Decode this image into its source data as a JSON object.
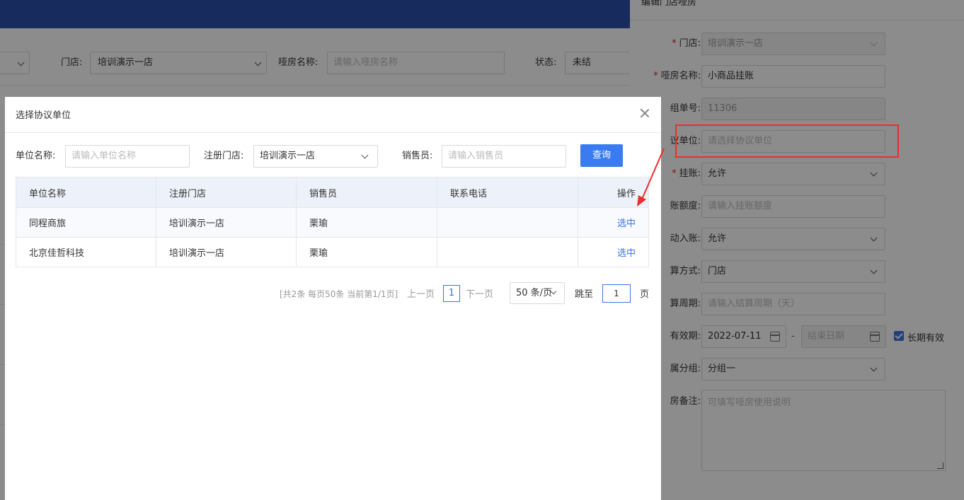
{
  "background": {
    "store_label": "门店:",
    "store_value": "培训演示一店",
    "room_name_label": "哑房名称:",
    "room_name_placeholder": "请输入哑房名称",
    "status_label": "状态:",
    "status_value": "未结"
  },
  "drawer": {
    "title": "编辑门店哑房",
    "fields": {
      "store": {
        "label": "门店:",
        "value": "培训演示一店"
      },
      "room_name": {
        "label": "哑房名称:",
        "value": "小商品挂账"
      },
      "group_no": {
        "label": "组单号:",
        "value": "11306"
      },
      "agreement_unit": {
        "label": "议单位:",
        "placeholder": "请选择协议单位"
      },
      "credit": {
        "label": "挂账:",
        "value": "允许"
      },
      "credit_limit": {
        "label": "账额度:",
        "placeholder": "请输入挂账额度"
      },
      "auto_post": {
        "label": "动入账:",
        "value": "允许"
      },
      "settle_method": {
        "label": "算方式:",
        "value": "门店"
      },
      "settle_period": {
        "label": "算周期:",
        "placeholder": "请输入结算周期（天）"
      },
      "validity": {
        "label": "有效期:",
        "start": "2022-07-11",
        "separator": "-",
        "end_placeholder": "结束日期",
        "long_term_label": "长期有效"
      },
      "group": {
        "label": "属分组:",
        "value": "分组一"
      },
      "remark": {
        "label": "房备注:",
        "placeholder": "可填写哑房使用说明"
      }
    }
  },
  "modal": {
    "title": "选择协议单位",
    "query": {
      "unit_name_label": "单位名称:",
      "unit_name_placeholder": "请输入单位名称",
      "store_label": "注册门店:",
      "store_value": "培训演示一店",
      "sales_label": "销售员:",
      "sales_placeholder": "请输入销售员",
      "query_button": "查询"
    },
    "table": {
      "columns": [
        "单位名称",
        "注册门店",
        "销售员",
        "联系电话",
        "操作"
      ],
      "rows": [
        {
          "unit": "同程商旅",
          "store": "培训演示一店",
          "sales": "栗瑜",
          "phone": "",
          "action": "选中"
        },
        {
          "unit": "北京佳哲科技",
          "store": "培训演示一店",
          "sales": "栗瑜",
          "phone": "",
          "action": "选中"
        }
      ]
    },
    "pager": {
      "info": "[共2条 每页50条 当前第1/1页]",
      "prev": "上一页",
      "current": "1",
      "next": "下一页",
      "page_size": "50 条/页",
      "jump_label": "跳至",
      "jump_value": "1",
      "page_suffix": "页"
    }
  },
  "colors": {
    "primary": "#3a7cf0",
    "topbar": "#2b4fa8",
    "annotation": "#e8302a"
  }
}
